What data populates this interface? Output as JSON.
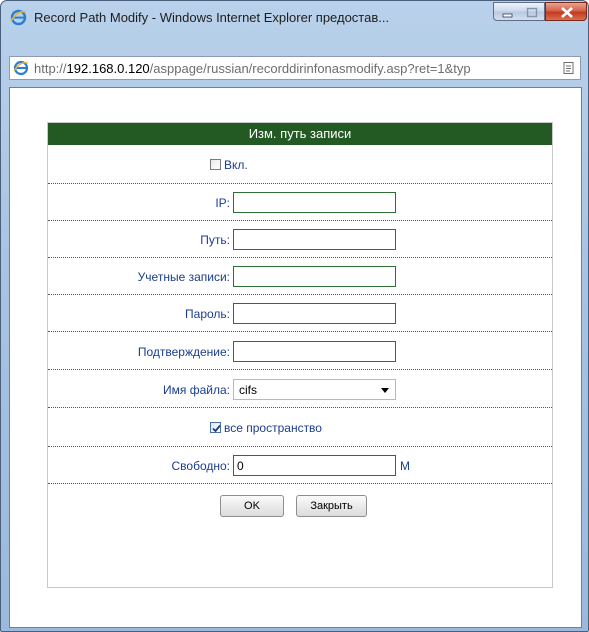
{
  "window": {
    "title": "Record Path Modify - Windows Internet Explorer предостав...",
    "url_prefix": "http://",
    "url_host": "192.168.0.120",
    "url_path": "/asppage/russian/recorddirinfonasmodify.asp?ret=1&typ"
  },
  "form": {
    "header": "Изм. путь записи",
    "enable_label": "Вкл.",
    "enable_checked": false,
    "ip_label": "IP:",
    "ip_value": "",
    "path_label": "Путь:",
    "path_value": "",
    "account_label": "Учетные записи:",
    "account_value": "",
    "password_label": "Пароль:",
    "password_value": "",
    "confirm_label": "Подтверждение:",
    "confirm_value": "",
    "filename_label": "Имя файла:",
    "filename_selected": "cifs",
    "all_space_label": "все пространство",
    "all_space_checked": true,
    "free_label": "Свободно:",
    "free_value": "0",
    "free_unit": "M",
    "ok_label": "OK",
    "close_label": "Закрыть"
  },
  "colors": {
    "header_bg": "#235a24",
    "label_text": "#1b3d8f",
    "field_border": "#2d6e32"
  }
}
